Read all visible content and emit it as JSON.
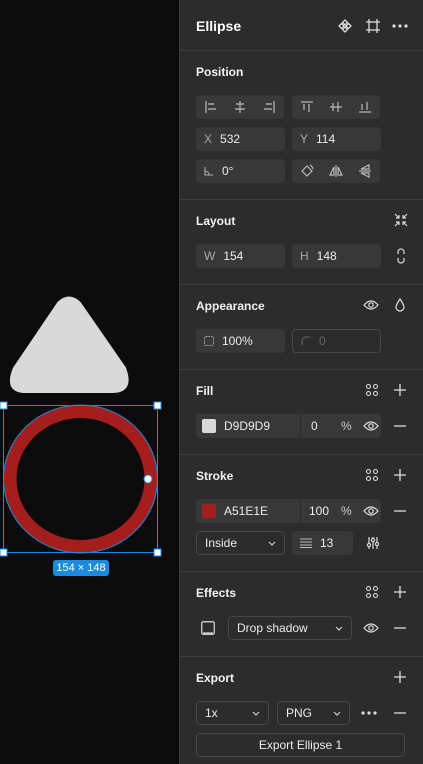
{
  "canvas": {
    "selection_label": "154 × 148",
    "triangle_fill": "#D9D9D9",
    "ellipse_stroke": "#A51E1E",
    "selection_color": "#1B8BE0"
  },
  "header": {
    "title": "Ellipse",
    "icons": [
      "component-icon",
      "frame-icon",
      "more-icon"
    ]
  },
  "position": {
    "title": "Position",
    "x_label": "X",
    "x_value": "532",
    "y_label": "Y",
    "y_value": "114",
    "rotation_value": "0°"
  },
  "layout": {
    "title": "Layout",
    "w_label": "W",
    "w_value": "154",
    "h_label": "H",
    "h_value": "148"
  },
  "appearance": {
    "title": "Appearance",
    "opacity_value": "100%",
    "radius_value": "0"
  },
  "fill": {
    "title": "Fill",
    "color_hex": "D9D9D9",
    "swatch_color": "#D9D9D9",
    "opacity": "0",
    "percent": "%"
  },
  "stroke": {
    "title": "Stroke",
    "color_hex": "A51E1E",
    "swatch_color": "#A51E1E",
    "opacity": "100",
    "percent": "%",
    "position": "Inside",
    "weight": "13"
  },
  "effects": {
    "title": "Effects",
    "effect_type": "Drop shadow"
  },
  "export": {
    "title": "Export",
    "scale": "1x",
    "format": "PNG",
    "button_label": "Export Ellipse 1"
  }
}
